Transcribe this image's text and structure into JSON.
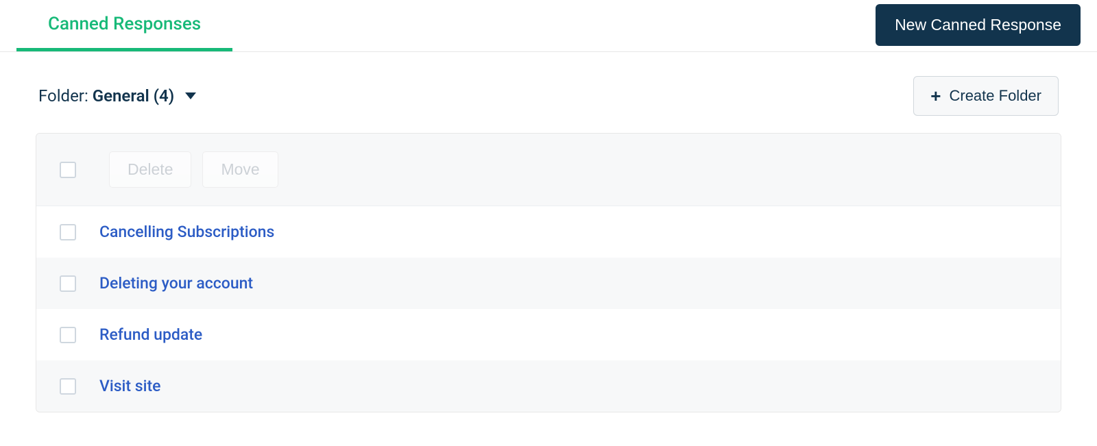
{
  "header": {
    "tab_label": "Canned Responses",
    "new_response_button": "New Canned Response"
  },
  "folder": {
    "label": "Folder:",
    "selected": "General (4)",
    "create_button": "Create Folder"
  },
  "actions": {
    "delete": "Delete",
    "move": "Move"
  },
  "items": [
    {
      "title": "Cancelling Subscriptions"
    },
    {
      "title": "Deleting your account"
    },
    {
      "title": "Refund update"
    },
    {
      "title": "Visit site"
    }
  ]
}
